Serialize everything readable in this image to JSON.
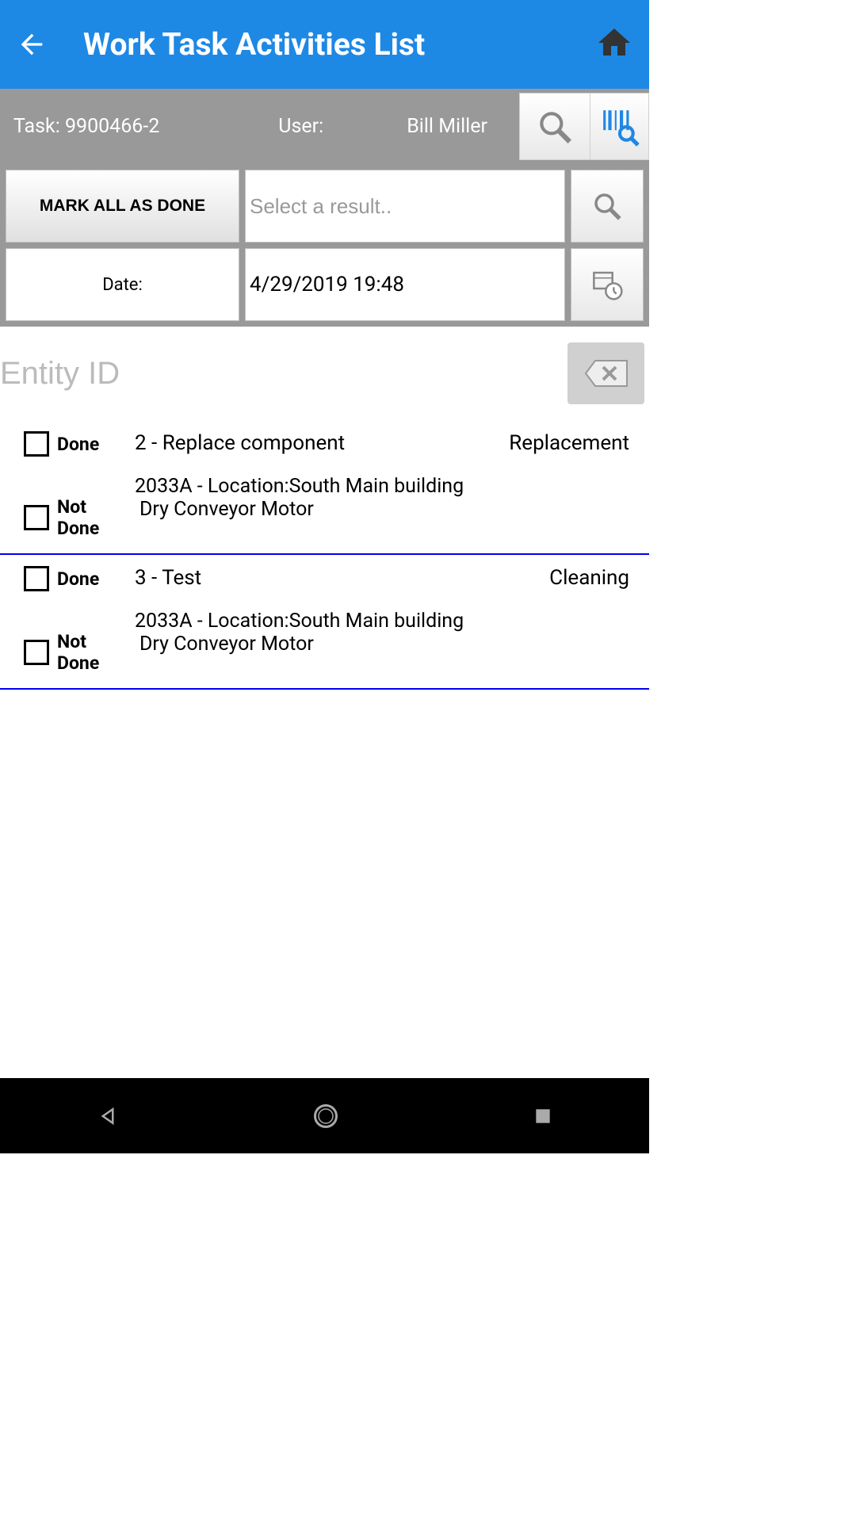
{
  "header": {
    "title": "Work Task Activities List"
  },
  "info_bar": {
    "task_label": "Task: 9900466-2",
    "user_label": "User:",
    "user_name": "Bill Miller"
  },
  "controls": {
    "mark_done_label": "MARK ALL AS DONE",
    "result_placeholder": "Select a result..",
    "date_label": "Date:",
    "date_value": "4/29/2019 19:48"
  },
  "entity": {
    "placeholder": "Entity ID"
  },
  "activities": [
    {
      "done_label": "Done",
      "not_done_label": "Not Done",
      "title": "2 - Replace component",
      "tag": "Replacement",
      "location": "2033A - Location:South Main building",
      "equipment": "Dry Conveyor Motor"
    },
    {
      "done_label": "Done",
      "not_done_label": "Not Done",
      "title": "3 - Test",
      "tag": "Cleaning",
      "location": "2033A - Location:South Main building",
      "equipment": "Dry Conveyor Motor"
    }
  ]
}
